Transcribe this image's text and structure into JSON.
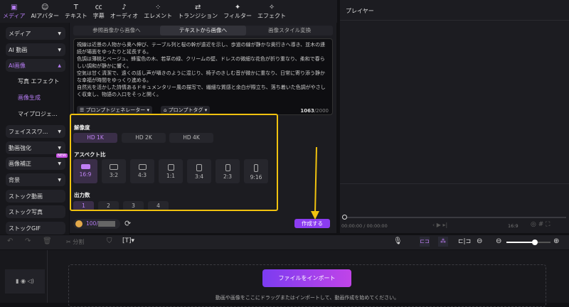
{
  "toolbar": {
    "items": [
      {
        "label": "メディア",
        "icon": "media-icon"
      },
      {
        "label": "AIアバター",
        "icon": "avatar-icon"
      },
      {
        "label": "テキスト",
        "icon": "text-icon"
      },
      {
        "label": "字幕",
        "icon": "caption-icon"
      },
      {
        "label": "オーディオ",
        "icon": "audio-icon"
      },
      {
        "label": "エレメント",
        "icon": "element-icon"
      },
      {
        "label": "トランジション",
        "icon": "transition-icon"
      },
      {
        "label": "フィルター",
        "icon": "filter-icon"
      },
      {
        "label": "エフェクト",
        "icon": "effect-icon"
      }
    ]
  },
  "sidebar": {
    "items": [
      "メディア",
      "AI 動画",
      "AI画像",
      "フェイススワ...",
      "動画強化",
      "画像補正",
      "背景",
      "ストック動画",
      "ストック写真",
      "ストックGIF"
    ],
    "sub": [
      "写真 エフェクト",
      "画像生成",
      "マイプロジェ..."
    ],
    "new_badge": "NEW"
  },
  "tabs": [
    "参照画像から画像へ",
    "テキストから画像へ",
    "画像スタイル変換"
  ],
  "prompt": {
    "text": "視線は近景の人物から奥へ伸び、テーブル列と桜の幹が遠近を示し、歩道の線が静かな奥行きへ導き、並木の連続が場面をゆったりと延長する。\n色調は薄桃とベージュ、蜂蜜色の木、若草の緑、クリームの壁、ドレスの微細な花色が折り重なり、柔和で春らしい調和が静かに響く。\n空気は甘く清潔で、遠くの話し声が囁きのように混じり、椅子のきしむ音が微かに重なり、日常に寄り添う静かな幸福が時間をゆっくり進める。\n自然光を活かした詩情あるドキュメンタリー風の描写で、繊細な質感と余白が際立ち、落ち着いた色調がやさしく収束し、物語の入口をそっと開く。",
    "generator": "プロンプトジェネレーター",
    "tag": "プロンプトタグ",
    "count": "1063",
    "max": "/2000"
  },
  "resolution": {
    "label": "解像度",
    "options": [
      "HD 1K",
      "HD 2K",
      "HD 4K"
    ],
    "selected": "HD 1K"
  },
  "aspect": {
    "label": "アスペクト比",
    "options": [
      "16:9",
      "3:2",
      "4:3",
      "1:1",
      "3:4",
      "2:3",
      "9:16"
    ],
    "selected": "16:9"
  },
  "output": {
    "label": "出力数",
    "options": [
      "1",
      "2",
      "3",
      "4"
    ],
    "selected": "1"
  },
  "credits": "100/",
  "generate": "作成する",
  "player": {
    "title": "プレイヤー",
    "time": "00:00:00 / 00:00:00",
    "ratio": "16:9"
  },
  "timeline": {
    "split": "分割"
  },
  "import": {
    "button": "ファイルをインポート",
    "hint": "動画や画像をここにドラッグまたはインポートして、動画作成を始めてください。"
  }
}
